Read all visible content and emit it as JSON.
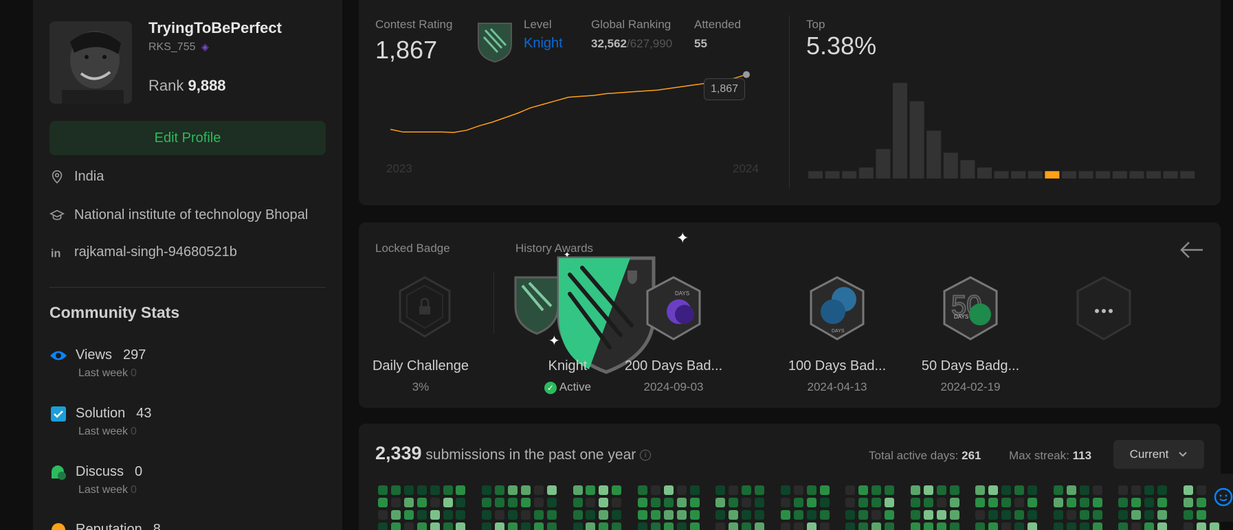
{
  "profile": {
    "username": "TryingToBePerfect",
    "handle": "RKS_755",
    "rank_label": "Rank",
    "rank_value": "9,888",
    "edit_label": "Edit Profile",
    "location": "India",
    "school": "National institute of technology Bhopal",
    "linkedin": "rajkamal-singh-94680521b"
  },
  "community": {
    "title": "Community Stats",
    "stats": [
      {
        "label": "Views",
        "value": "297",
        "last_week_label": "Last week",
        "last_week": "0",
        "color": "#0a84ff"
      },
      {
        "label": "Solution",
        "value": "43",
        "last_week_label": "Last week",
        "last_week": "0",
        "color": "#1b9fd9"
      },
      {
        "label": "Discuss",
        "value": "0",
        "last_week_label": "Last week",
        "last_week": "0",
        "color": "#2cbb5d"
      },
      {
        "label": "Reputation",
        "value": "8",
        "color": "#ffa116"
      }
    ]
  },
  "contest": {
    "rating_label": "Contest Rating",
    "rating": "1,867",
    "level_label": "Level",
    "level": "Knight",
    "ranking_label": "Global Ranking",
    "ranking": "32,562",
    "ranking_total": "/627,990",
    "attended_label": "Attended",
    "attended": "55",
    "top_label": "Top",
    "top_value": "5.38%",
    "tooltip": "1,867",
    "year_start": "2023",
    "year_end": "2024",
    "accent": "#ffa116"
  },
  "chart_data": [
    {
      "type": "line",
      "title": "",
      "x": [
        "2023",
        "2024"
      ],
      "series": [
        {
          "values": [
            1560,
            1545,
            1545,
            1545,
            1545,
            1543,
            1555,
            1580,
            1600,
            1625,
            1650,
            1680,
            1700,
            1720,
            1740,
            1745,
            1750,
            1760,
            1765,
            1770,
            1775,
            1780,
            1790,
            1800,
            1810,
            1820,
            1830,
            1845,
            1867
          ]
        }
      ]
    },
    {
      "type": "bar",
      "title": "",
      "values": [
        2,
        2,
        2,
        3,
        8,
        26,
        21,
        13,
        7,
        5,
        3,
        2,
        2,
        2,
        2,
        2,
        2,
        2,
        2,
        2,
        2,
        2,
        2
      ],
      "highlight_index": 14
    }
  ],
  "badges": {
    "locked_label": "Locked Badge",
    "history_label": "History Awards",
    "items": [
      {
        "name": "Daily Challenge",
        "sub": "3%"
      },
      {
        "name": "Knight",
        "sub": "Active"
      },
      {
        "name": "200 Days Bad...",
        "sub": "2024-09-03"
      },
      {
        "name": "100 Days Bad...",
        "sub": "2024-04-13"
      },
      {
        "name": "50 Days Badg...",
        "sub": "2024-02-19"
      }
    ],
    "days_label": "DAYS",
    "days_num": "50"
  },
  "submissions": {
    "count": "2,339",
    "label": "submissions in the past one year",
    "active_label": "Total active days:",
    "active": "261",
    "streak_label": "Max streak:",
    "streak": "113",
    "dropdown": "Current"
  }
}
